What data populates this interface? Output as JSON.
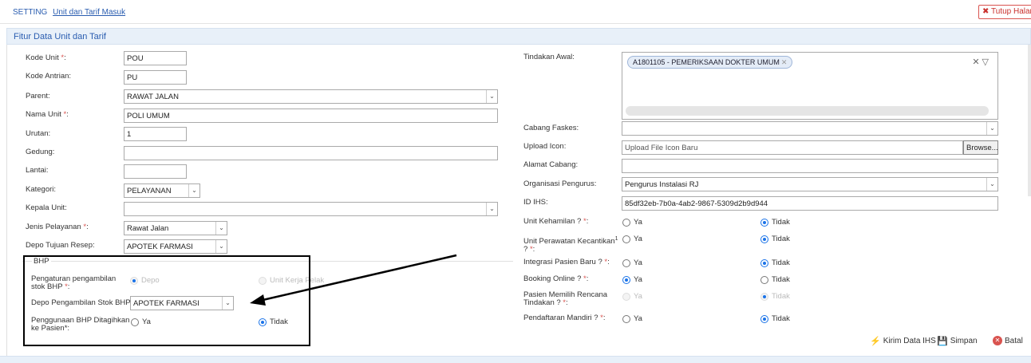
{
  "header": {
    "section": "SETTING",
    "page_link": "Unit dan Tarif Masuk",
    "close_label": "Tutup Halam"
  },
  "panel": {
    "title": "Fitur Data Unit dan Tarif"
  },
  "left": {
    "kode_unit": {
      "label": "Kode Unit",
      "value": "POU"
    },
    "kode_antrian": {
      "label": "Kode Antrian:",
      "value": "PU"
    },
    "parent": {
      "label": "Parent:",
      "value": "RAWAT JALAN"
    },
    "nama_unit": {
      "label": "Nama Unit",
      "value": "POLI UMUM"
    },
    "urutan": {
      "label": "Urutan:",
      "value": "1"
    },
    "gedung": {
      "label": "Gedung:",
      "value": ""
    },
    "lantai": {
      "label": "Lantai:",
      "value": ""
    },
    "kategori": {
      "label": "Kategori:",
      "value": "PELAYANAN"
    },
    "kepala_unit": {
      "label": "Kepala Unit:",
      "value": ""
    },
    "jenis_pelayanan": {
      "label": "Jenis Pelayanan",
      "value": "Rawat Jalan"
    },
    "depo_resep": {
      "label": "Depo Tujuan Resep:",
      "value": "APOTEK FARMASI"
    }
  },
  "bhp": {
    "legend": "BHP",
    "pengaturan": {
      "label": "Pengaturan pengambilan stok BHP",
      "opt1": "Depo",
      "opt2": "Unit Kerja Pelak"
    },
    "depo_stok": {
      "label": "Depo Pengambilan Stok BHP:",
      "value": "APOTEK FARMASI"
    },
    "ditagihkan": {
      "label": "Penggunaan BHP Ditagihkan ke Pasien*:",
      "ya": "Ya",
      "tidak": "Tidak"
    }
  },
  "right": {
    "tindakan_awal": {
      "label": "Tindakan Awal:",
      "tag": "A1801105 - PEMERIKSAAN DOKTER UMUM"
    },
    "cabang_faskes": {
      "label": "Cabang Faskes:",
      "value": ""
    },
    "upload_icon": {
      "label": "Upload Icon:",
      "placeholder": "Upload File Icon Baru",
      "browse": "Browse..."
    },
    "alamat_cabang": {
      "label": "Alamat Cabang:",
      "value": ""
    },
    "organisasi": {
      "label": "Organisasi Pengurus:",
      "value": "Pengurus Instalasi RJ"
    },
    "id_ihs": {
      "label": "ID IHS:",
      "value": "85df32eb-7b0a-4ab2-9867-5309d2b9d944"
    },
    "kehamilan": {
      "label": "Unit Kehamilan ?",
      "ya": "Ya",
      "tidak": "Tidak"
    },
    "kecantikan": {
      "label": "Unit Perawatan Kecantikan",
      "sup": "1",
      "suffix": " ?",
      "ya": "Ya",
      "tidak": "Tidak"
    },
    "integrasi": {
      "label": "Integrasi Pasien Baru ?",
      "ya": "Ya",
      "tidak": "Tidak"
    },
    "booking": {
      "label": "Booking Online ?",
      "ya": "Ya",
      "tidak": "Tidak"
    },
    "rencana": {
      "label": "Pasien Memilih Rencana Tindakan ?",
      "ya": "Ya",
      "tidak": "Tidak"
    },
    "mandiri": {
      "label": "Pendaftaran Mandiri ?",
      "ya": "Ya",
      "tidak": "Tidak"
    }
  },
  "actions": {
    "kirim": "Kirim Data IHS",
    "simpan": "Simpan",
    "batal": "Batal"
  }
}
